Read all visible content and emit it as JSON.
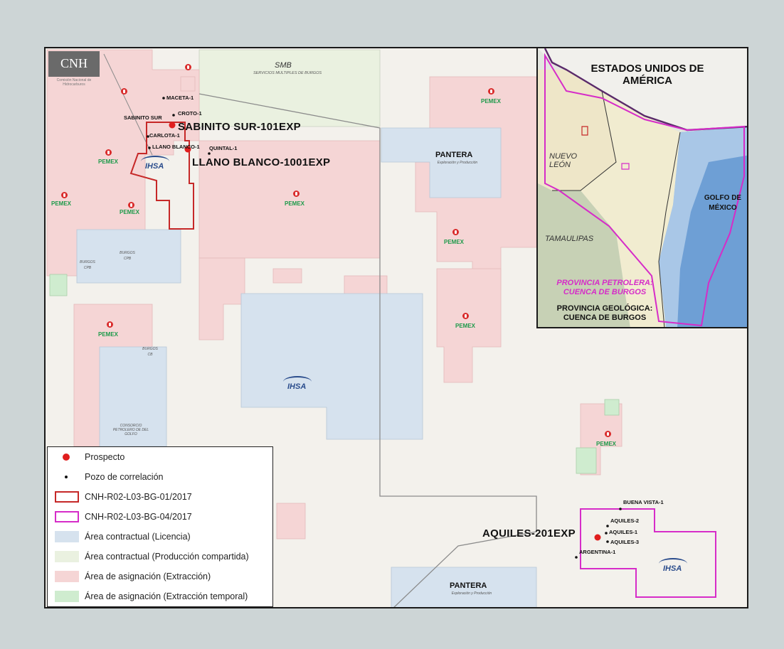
{
  "logo": {
    "text": "CNH",
    "subtitle": "Comisión Nacional de Hidrocarburos"
  },
  "colors": {
    "licencia": "#d6e2ee",
    "produccion_compartida": "#eaf1e0",
    "asignacion_extraccion": "#f5d5d5",
    "asignacion_temporal": "#cfeccf",
    "bg01_border": "#c62828",
    "bg04_border": "#d62cc8",
    "prospect": "#e01e1e",
    "pemex_text": "#1d9a4a"
  },
  "map": {
    "areas": [
      {
        "name": "SMB",
        "sub": "SERVICIOS MULTIPLES DE BURGOS"
      },
      {
        "name": "PANTERA",
        "sub": "Exploración y Producción"
      },
      {
        "name": "PANTERA",
        "sub": "Exploración y Producción"
      },
      {
        "name": "BURGOS",
        "sub": "CPB"
      },
      {
        "name": "BURGOS",
        "sub": "CPB"
      },
      {
        "name": "BURGOS",
        "sub": "CB"
      },
      {
        "name": "CONSORCIO PETROLERO DE DEL GOLFO",
        "sub": ""
      }
    ],
    "operator_pemex": "PEMEX",
    "operator_ihsa": "IHSA",
    "prospects": [
      {
        "name": "SABINITO SUR-101EXP"
      },
      {
        "name": "LLANO BLANCO-1001EXP"
      },
      {
        "name": "AQUILES-201EXP"
      }
    ],
    "wells": [
      {
        "name": "MACETA-1"
      },
      {
        "name": "SABINITO SUR"
      },
      {
        "name": "CROTO-1"
      },
      {
        "name": "CARLOTA-1"
      },
      {
        "name": "LLANO BLANCO-1"
      },
      {
        "name": "QUINTAL-1"
      },
      {
        "name": "BUENA VISTA-1"
      },
      {
        "name": "AQUILES-2"
      },
      {
        "name": "AQUILES-1"
      },
      {
        "name": "AQUILES-3"
      },
      {
        "name": "ARGENTINA-1"
      }
    ]
  },
  "inset": {
    "country": "ESTADOS UNIDOS DE AMÉRICA",
    "states": [
      "NUEVO LEÓN",
      "TAMAULIPAS"
    ],
    "gulf": "GOLFO DE MÉXICO",
    "prov_petrolera": "PROVINCIA PETROLERA: CUENCA DE BURGOS",
    "prov_geologica": "PROVINCIA GEOLÓGICA: CUENCA DE BURGOS"
  },
  "legend": {
    "items": [
      {
        "label": "Prospecto",
        "symbol": "prospect-dot"
      },
      {
        "label": "Pozo de correlación",
        "symbol": "well-dot"
      },
      {
        "label": "CNH-R02-L03-BG-01/2017",
        "symbol": "red-outline"
      },
      {
        "label": "CNH-R02-L03-BG-04/2017",
        "symbol": "magenta-outline"
      },
      {
        "label": "Área contractual (Licencia)",
        "symbol": "blue-fill"
      },
      {
        "label": "Área contractual (Producción compartida)",
        "symbol": "yellow-green-fill"
      },
      {
        "label": "Área de asignación (Extracción)",
        "symbol": "pink-fill"
      },
      {
        "label": "Área de asignación (Extracción temporal)",
        "symbol": "green-fill"
      }
    ]
  }
}
